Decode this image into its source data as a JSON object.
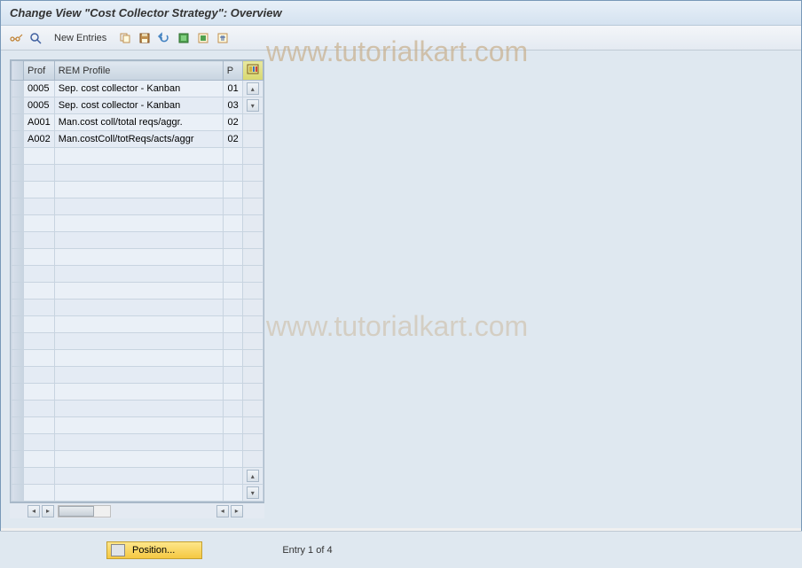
{
  "title": "Change View \"Cost Collector Strategy\": Overview",
  "toolbar": {
    "new_entries": "New Entries"
  },
  "table": {
    "headers": {
      "prof": "Prof",
      "rem": "REM Profile",
      "p": "P"
    },
    "rows": [
      {
        "prof": "0005",
        "rem": "Sep. cost collector - Kanban",
        "p": "01"
      },
      {
        "prof": "0005",
        "rem": "Sep. cost collector - Kanban",
        "p": "03"
      },
      {
        "prof": "A001",
        "rem": "Man.cost coll/total reqs/aggr.",
        "p": "02"
      },
      {
        "prof": "A002",
        "rem": "Man.costColl/totReqs/acts/aggr",
        "p": "02"
      }
    ],
    "empty_rows": 21
  },
  "footer": {
    "position_label": "Position...",
    "entry_text": "Entry 1 of 4"
  },
  "watermark": "www.tutorialkart.com"
}
